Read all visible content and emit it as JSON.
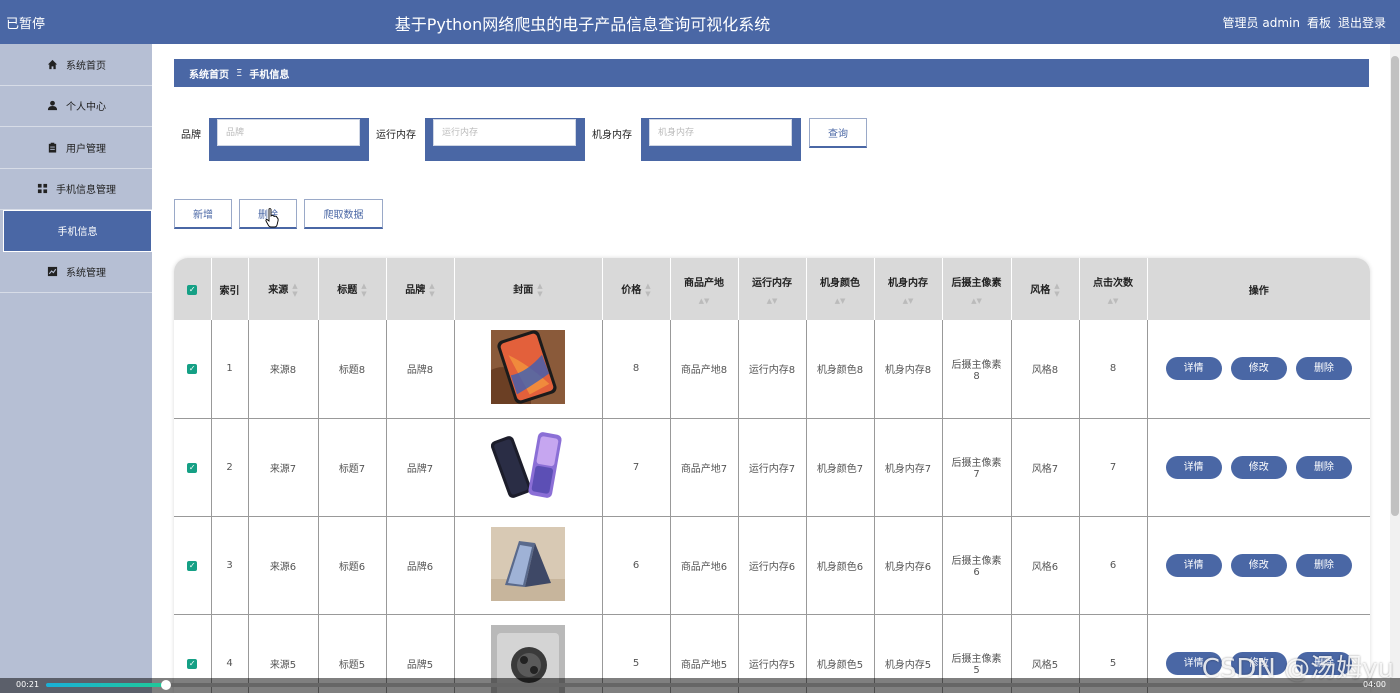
{
  "header": {
    "paused": "已暂停",
    "title": "基于Python网络爬虫的电子产品信息查询可视化系统",
    "user": "管理员 admin",
    "board": "看板",
    "logout": "退出登录"
  },
  "sidebar": {
    "items": [
      {
        "label": "系统首页",
        "icon": "home-icon"
      },
      {
        "label": "个人中心",
        "icon": "user-icon"
      },
      {
        "label": "用户管理",
        "icon": "clipboard-icon"
      },
      {
        "label": "手机信息管理",
        "icon": "grid-icon"
      },
      {
        "label": "手机信息",
        "icon": ""
      },
      {
        "label": "系统管理",
        "icon": "chart-icon"
      }
    ]
  },
  "breadcrumb": {
    "home": "系统首页",
    "sep": "Ξ",
    "current": "手机信息"
  },
  "search": {
    "brand_label": "品牌",
    "brand_placeholder": "品牌",
    "ram_label": "运行内存",
    "ram_placeholder": "运行内存",
    "storage_label": "机身内存",
    "storage_placeholder": "机身内存",
    "query": "查询"
  },
  "actions": {
    "add": "新增",
    "delete": "删除",
    "crawl": "爬取数据"
  },
  "table": {
    "headers": {
      "index": "索引",
      "source": "来源",
      "title": "标题",
      "brand": "品牌",
      "cover": "封面",
      "price": "价格",
      "origin": "商品产地",
      "ram": "运行内存",
      "color": "机身颜色",
      "storage": "机身内存",
      "camera": "后摄主像素",
      "style": "风格",
      "clicks": "点击次数",
      "ops": "操作"
    },
    "rows": [
      {
        "index": "1",
        "source": "来源8",
        "title": "标题8",
        "brand": "品牌8",
        "price": "8",
        "origin": "商品产地8",
        "ram": "运行内存8",
        "color": "机身颜色8",
        "storage": "机身内存8",
        "camera1": "后摄主像素",
        "camera2": "8",
        "style": "风格8",
        "clicks": "8"
      },
      {
        "index": "2",
        "source": "来源7",
        "title": "标题7",
        "brand": "品牌7",
        "price": "7",
        "origin": "商品产地7",
        "ram": "运行内存7",
        "color": "机身颜色7",
        "storage": "机身内存7",
        "camera1": "后摄主像素",
        "camera2": "7",
        "style": "风格7",
        "clicks": "7"
      },
      {
        "index": "3",
        "source": "来源6",
        "title": "标题6",
        "brand": "品牌6",
        "price": "6",
        "origin": "商品产地6",
        "ram": "运行内存6",
        "color": "机身颜色6",
        "storage": "机身内存6",
        "camera1": "后摄主像素",
        "camera2": "6",
        "style": "风格6",
        "clicks": "6"
      },
      {
        "index": "4",
        "source": "来源5",
        "title": "标题5",
        "brand": "品牌5",
        "price": "5",
        "origin": "商品产地5",
        "ram": "运行内存5",
        "color": "机身颜色5",
        "storage": "机身内存5",
        "camera1": "后摄主像素",
        "camera2": "5",
        "style": "风格5",
        "clicks": "5"
      }
    ],
    "ops": {
      "detail": "详情",
      "edit": "修改",
      "delete": "删除"
    }
  },
  "video": {
    "elapsed": "00:21",
    "total": "04:00",
    "progress": 0.09
  },
  "watermark": "CSDN @汤姆yu",
  "colors": {
    "primary": "#4a67a5",
    "sidebar": "#b6bfd4",
    "checkbox": "#15a085",
    "header_cell": "#d9d9d9"
  }
}
